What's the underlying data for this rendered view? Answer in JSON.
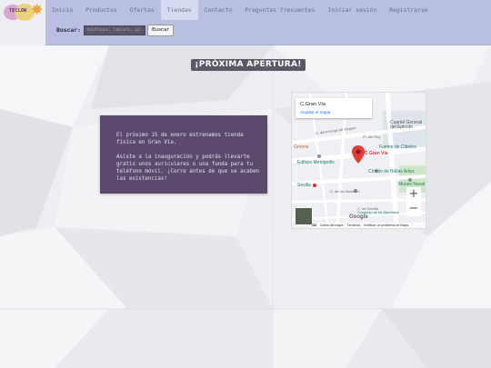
{
  "logo": {
    "text": "TECLOW"
  },
  "nav": {
    "items": [
      {
        "label": "Inicio"
      },
      {
        "label": "Productos"
      },
      {
        "label": "Ofertas"
      },
      {
        "label": "Tiendas"
      },
      {
        "label": "Contacto"
      },
      {
        "label": "Preguntas frecuentes"
      },
      {
        "label": "Iniciar sesión"
      },
      {
        "label": "Registrarse"
      }
    ],
    "active": "Tiendas"
  },
  "search": {
    "label": "Buscar:",
    "placeholder": "teléfonos, tablets, pc...",
    "button_label": "Buscar"
  },
  "main": {
    "title": "¡PRÓXIMA APERTURA!",
    "paragraph1": "El próximo 15 de enero estrenamos tienda física en Gran Vía.",
    "paragraph2": "Asiste a la inauguración y podrás llevarte gratis unos auriculares o una funda para tu teléfono móvil. ¡Corre antes de que se acaben las existencias!"
  },
  "map": {
    "place_title": "C.Gran Vía",
    "enlarge_link": "Ampliar el mapa",
    "marker_label": "C.Gran Vía",
    "labels": [
      "Cuartel General del Ejército",
      "C. del Príncipe de Vergara",
      "Pl. del Rey",
      "Fuente de Cibeles",
      "Edificio Metrópolis",
      "Círculo de Bellas Artes",
      "Museo Naval",
      "Sevilla",
      "C. de los Madrazo",
      "C. de Zorrilla",
      "Congreso de los Diputados",
      "Google",
      "Greens"
    ],
    "zoom_in": "+",
    "zoom_out": "−",
    "footer": {
      "keyboard": "⌨",
      "data": "Datos del mapa",
      "terms": "Términos",
      "report": "Notificar un problema de Maps"
    }
  },
  "colors": {
    "nav_bg": "#b8bfe0",
    "card_bg": "#5b4a6d",
    "title_bg": "#5a5a66",
    "marker": "#e53935"
  }
}
